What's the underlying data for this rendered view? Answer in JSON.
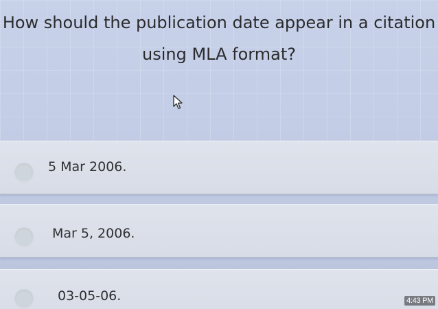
{
  "question": {
    "line1": "How should the publication date appear in a citation",
    "line2": "using MLA format?"
  },
  "options": [
    {
      "label": "5 Mar 2006."
    },
    {
      "label": "Mar 5, 2006."
    },
    {
      "label": "03-05-06."
    }
  ],
  "taskbar": {
    "time": "4:43 PM"
  },
  "icons": {
    "pointer": "mouse-pointer-icon"
  }
}
